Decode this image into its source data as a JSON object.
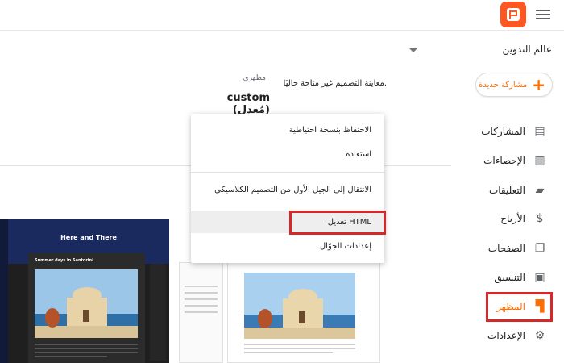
{
  "topbar": {
    "app_logo": "blogger-logo",
    "menu_icon": "hamburger-icon"
  },
  "blog_selector": {
    "value": "عالم التدوين",
    "icon": "dropdown-caret-icon"
  },
  "new_post": {
    "label": "مشاركة جديدة",
    "icon": "plus-icon"
  },
  "theme": {
    "label": "مظهري",
    "name": "custom (مُعدل)",
    "preview_note": "معاينة التصميم غير متاحة حاليًا."
  },
  "sidebar": {
    "items": [
      {
        "label": "المشاركات",
        "icon": "posts-icon",
        "active": false
      },
      {
        "label": "الإحصاءات",
        "icon": "stats-icon",
        "active": false
      },
      {
        "label": "التعليقات",
        "icon": "comments-icon",
        "active": false
      },
      {
        "label": "الأرباح",
        "icon": "earnings-icon",
        "active": false
      },
      {
        "label": "الصفحات",
        "icon": "pages-icon",
        "active": false
      },
      {
        "label": "التنسيق",
        "icon": "layout-icon",
        "active": false
      },
      {
        "label": "المظهر",
        "icon": "theme-icon",
        "active": true
      },
      {
        "label": "الإعدادات",
        "icon": "settings-icon",
        "active": false
      }
    ]
  },
  "menu": {
    "items": [
      {
        "label": "الاحتفاظ بنسخة احتياطية"
      },
      {
        "label": "استعادة"
      },
      {
        "label": "الانتقال إلى الجيل الأول من التصميم الكلاسيكي"
      },
      {
        "label": "تعديل HTML"
      },
      {
        "label": "إعدادات الجوّال"
      }
    ]
  },
  "preview": {
    "dark_title": "Here and There",
    "dark_post_title": "Summer days in Santorini"
  },
  "colors": {
    "accent": "#ff6d00",
    "highlight_box": "#d62828",
    "logo": "#ff5722"
  }
}
